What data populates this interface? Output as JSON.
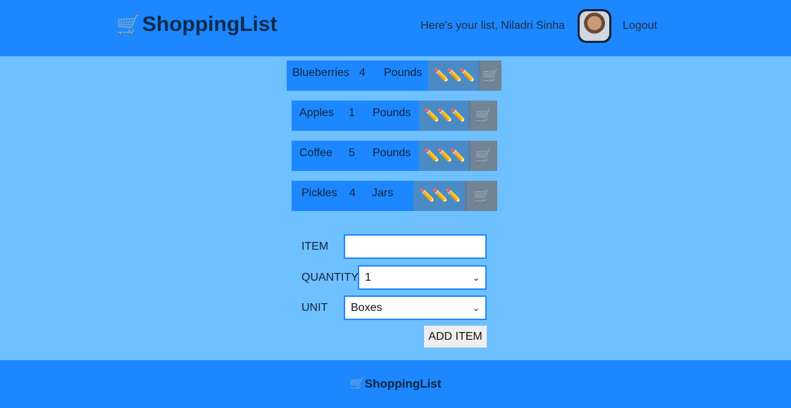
{
  "header": {
    "brand": "ShoppingList",
    "cart_icon": "🛒",
    "greeting": "Here's your list, Niladri Sinha",
    "logout_label": "Logout"
  },
  "items": [
    {
      "name": "Blueberries",
      "quantity": "4",
      "unit": "Pounds",
      "edit_icon": "✏️✏️✏️",
      "delete_icon": "🛒"
    },
    {
      "name": "Apples",
      "quantity": "1",
      "unit": "Pounds",
      "edit_icon": "✏️✏️✏️",
      "delete_icon": "🛒"
    },
    {
      "name": "Coffee",
      "quantity": "5",
      "unit": "Pounds",
      "edit_icon": "✏️✏️✏️",
      "delete_icon": "🛒"
    },
    {
      "name": "Pickles",
      "quantity": "4",
      "unit": "Jars",
      "edit_icon": "✏️✏️✏️",
      "delete_icon": "🛒"
    }
  ],
  "form": {
    "item_label": "ITEM",
    "item_value": "",
    "quantity_label": "QUANTITY",
    "quantity_value": "1",
    "unit_label": "UNIT",
    "unit_value": "Boxes",
    "add_label": "ADD ITEM"
  },
  "footer": {
    "brand": "ShoppingList",
    "cart_icon": "🛒"
  },
  "colors": {
    "header_bg": "#1c87ff",
    "page_bg": "#6ec0ff",
    "action_bg": "#4a8bc6"
  }
}
